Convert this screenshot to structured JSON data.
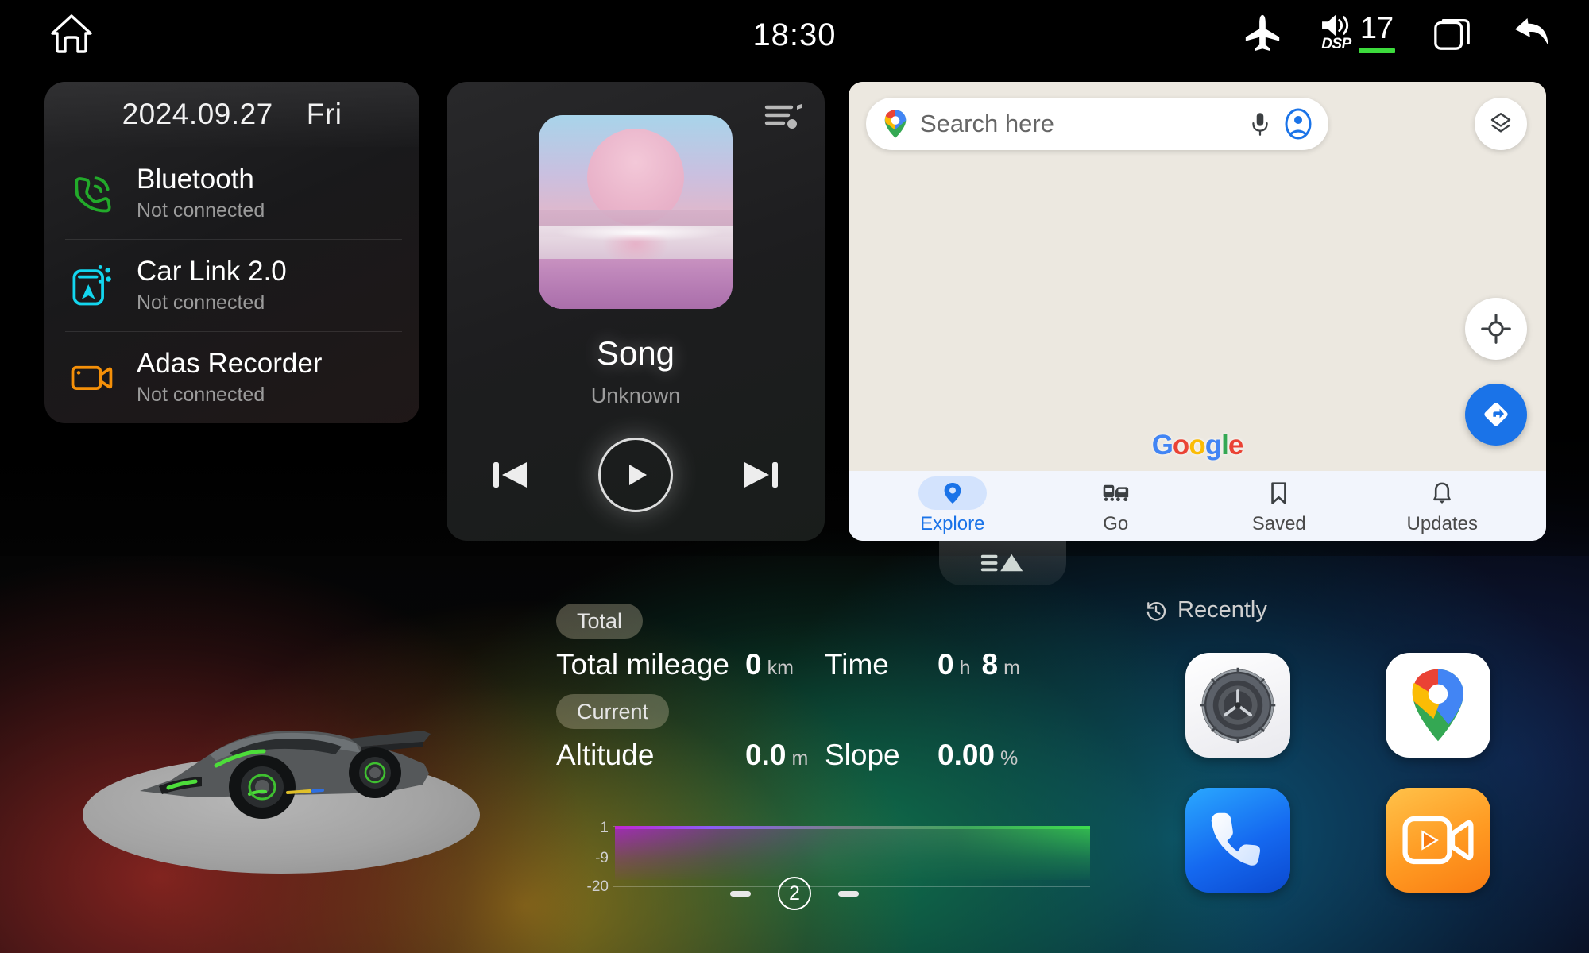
{
  "status_bar": {
    "home_icon": "home-icon",
    "time": "18:30",
    "airplane_icon": "airplane-mode-icon",
    "dsp_label": "DSP",
    "volume": "17",
    "recents_icon": "recent-apps-icon",
    "back_icon": "back-arrow-icon"
  },
  "left_card": {
    "date": "2024.09.27",
    "weekday": "Fri",
    "items": [
      {
        "title": "Bluetooth",
        "status": "Not connected",
        "icon": "bluetooth-phone-icon",
        "color": "#22aa2a"
      },
      {
        "title": "Car Link 2.0",
        "status": "Not connected",
        "icon": "car-link-icon",
        "color": "#13d6ef"
      },
      {
        "title": "Adas Recorder",
        "status": "Not connected",
        "icon": "video-camera-icon",
        "color": "#f59009"
      }
    ]
  },
  "music": {
    "playlist_icon": "playlist-music-icon",
    "album_art": "album-art-pink-landscape",
    "title": "Song",
    "artist": "Unknown",
    "prev_icon": "skip-previous-icon",
    "play_icon": "play-icon",
    "next_icon": "skip-next-icon"
  },
  "maps": {
    "logo_icon": "google-maps-pin-icon",
    "search_placeholder": "Search here",
    "mic_icon": "microphone-icon",
    "account_icon": "account-avatar-icon",
    "layers_icon": "map-layers-icon",
    "locate_icon": "my-location-icon",
    "directions_icon": "directions-icon",
    "watermark": "Google",
    "watermark_letters": [
      {
        "ch": "G",
        "color": "#4285F4"
      },
      {
        "ch": "o",
        "color": "#EA4335"
      },
      {
        "ch": "o",
        "color": "#FBBC05"
      },
      {
        "ch": "g",
        "color": "#4285F4"
      },
      {
        "ch": "l",
        "color": "#34A853"
      },
      {
        "ch": "e",
        "color": "#EA4335"
      }
    ],
    "nav": [
      {
        "label": "Explore",
        "icon": "map-pin-icon",
        "active": true
      },
      {
        "label": "Go",
        "icon": "commute-icon",
        "active": false
      },
      {
        "label": "Saved",
        "icon": "bookmark-icon",
        "active": false
      },
      {
        "label": "Updates",
        "icon": "bell-icon",
        "active": false
      }
    ],
    "handle_icon": "expand-list-icon",
    "accent_color": "#1a73e8"
  },
  "drive_stats": {
    "total_badge": "Total",
    "mileage_label": "Total mileage",
    "mileage_value": "0",
    "mileage_unit": "km",
    "time_label": "Time",
    "time_hours": "0",
    "time_hours_unit": "h",
    "time_minutes": "8",
    "time_minutes_unit": "m",
    "current_badge": "Current",
    "altitude_label": "Altitude",
    "altitude_value": "0.0",
    "altitude_unit": "m",
    "slope_label": "Slope",
    "slope_value": "0.00",
    "slope_unit": "%",
    "page_indicator": "2"
  },
  "chart_data": {
    "type": "area",
    "title": "Altitude",
    "xlabel": "",
    "ylabel": "m",
    "yticks": [
      "1",
      "-9",
      "-20"
    ],
    "ylim": [
      -20,
      1
    ],
    "grid": true,
    "legend": "none",
    "series": [
      {
        "name": "Altitude",
        "values": [
          0,
          0,
          0,
          0,
          0,
          0,
          0,
          0,
          0,
          0
        ]
      }
    ],
    "gradient_from": "#c026d3",
    "gradient_to": "#3ddc4e"
  },
  "recently": {
    "icon": "history-clock-icon",
    "label": "Recently",
    "apps": [
      {
        "name": "Settings",
        "icon": "settings-gear-icon"
      },
      {
        "name": "Google Maps",
        "icon": "google-maps-icon"
      },
      {
        "name": "Phone",
        "icon": "phone-handset-icon"
      },
      {
        "name": "Video Recorder",
        "icon": "video-recorder-icon"
      }
    ]
  },
  "car": {
    "model_icon": "sports-car-render"
  }
}
